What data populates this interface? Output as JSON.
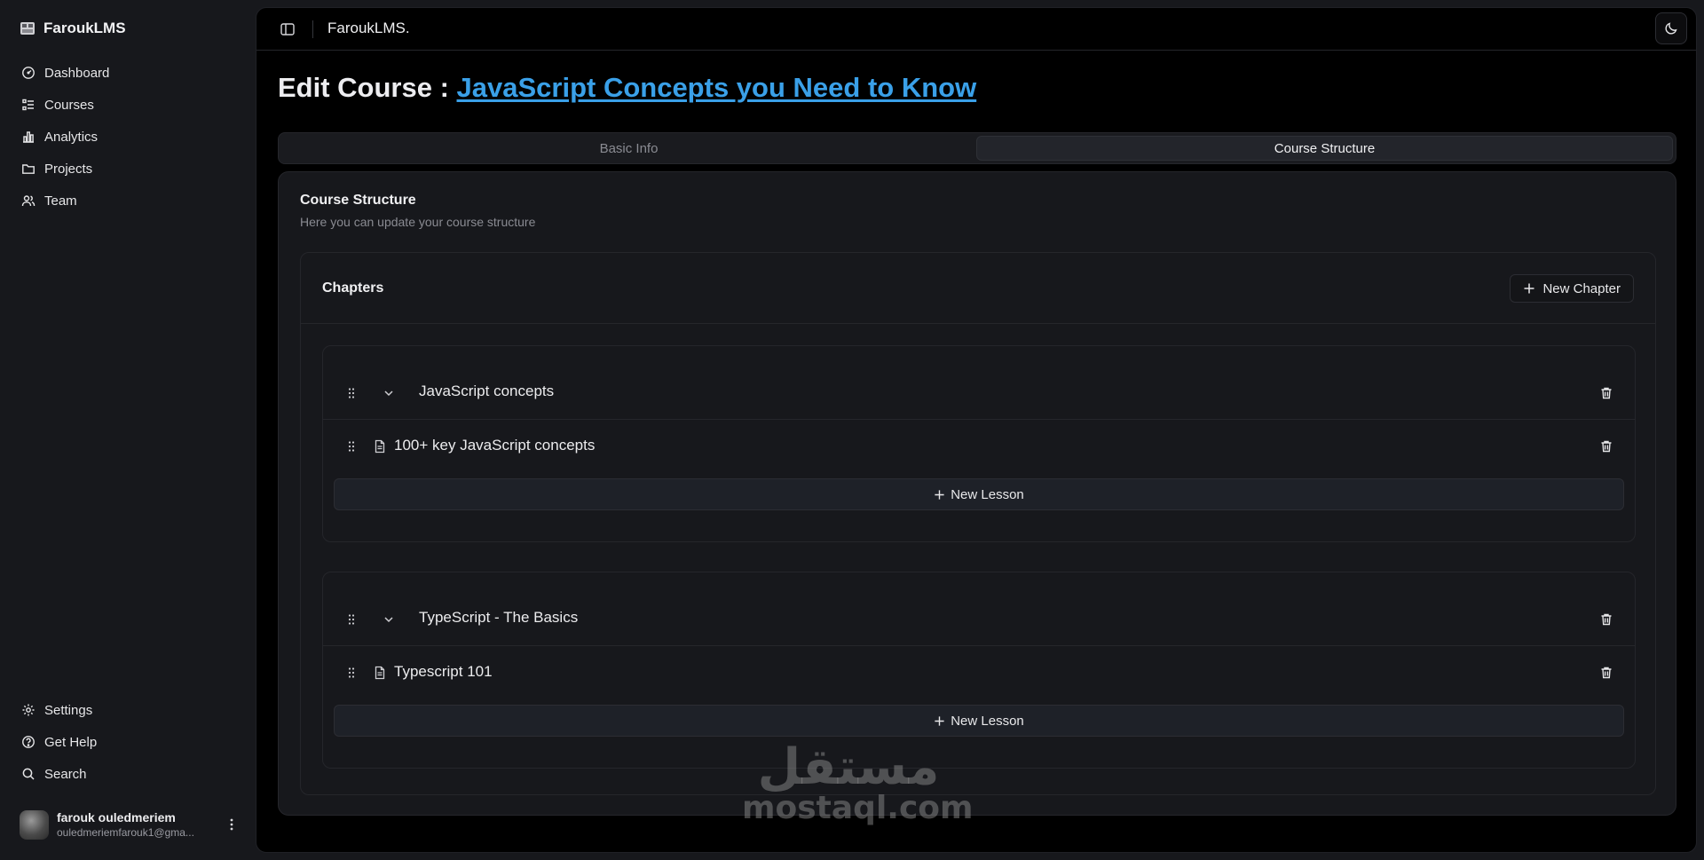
{
  "app": {
    "brand": "FaroukLMS"
  },
  "sidebar": {
    "nav": [
      {
        "label": "Dashboard",
        "icon": "dashboard-gauge-icon"
      },
      {
        "label": "Courses",
        "icon": "list-icon"
      },
      {
        "label": "Analytics",
        "icon": "bar-chart-icon"
      },
      {
        "label": "Projects",
        "icon": "folder-icon"
      },
      {
        "label": "Team",
        "icon": "users-icon"
      }
    ],
    "bottom_nav": [
      {
        "label": "Settings",
        "icon": "settings-icon"
      },
      {
        "label": "Get Help",
        "icon": "help-circle-icon"
      },
      {
        "label": "Search",
        "icon": "search-icon"
      }
    ],
    "user": {
      "name": "farouk ouledmeriem",
      "email": "ouledmeriemfarouk1@gma..."
    }
  },
  "topbar": {
    "title": "FaroukLMS."
  },
  "page": {
    "title_prefix": "Edit Course : ",
    "course_title": "JavaScript Concepts you Need to Know"
  },
  "tabs": [
    {
      "label": "Basic Info",
      "active": false
    },
    {
      "label": "Course Structure",
      "active": true
    }
  ],
  "card": {
    "title": "Course Structure",
    "description": "Here you can update your course structure"
  },
  "chapters": {
    "title": "Chapters",
    "new_chapter_label": "New Chapter",
    "items": [
      {
        "name": "JavaScript concepts",
        "lessons": [
          {
            "name": "100+ key JavaScript concepts"
          }
        ],
        "new_lesson_label": "New Lesson"
      },
      {
        "name": "TypeScript - The Basics",
        "lessons": [
          {
            "name": "Typescript 101"
          }
        ],
        "new_lesson_label": "New Lesson"
      }
    ]
  },
  "watermark": {
    "arabic": "مستقل",
    "latin": "mostaql.com"
  },
  "colors": {
    "background": "#17181c",
    "main_panel": "#000000",
    "link_accent": "#3aa0e8",
    "border": "#25262b"
  }
}
